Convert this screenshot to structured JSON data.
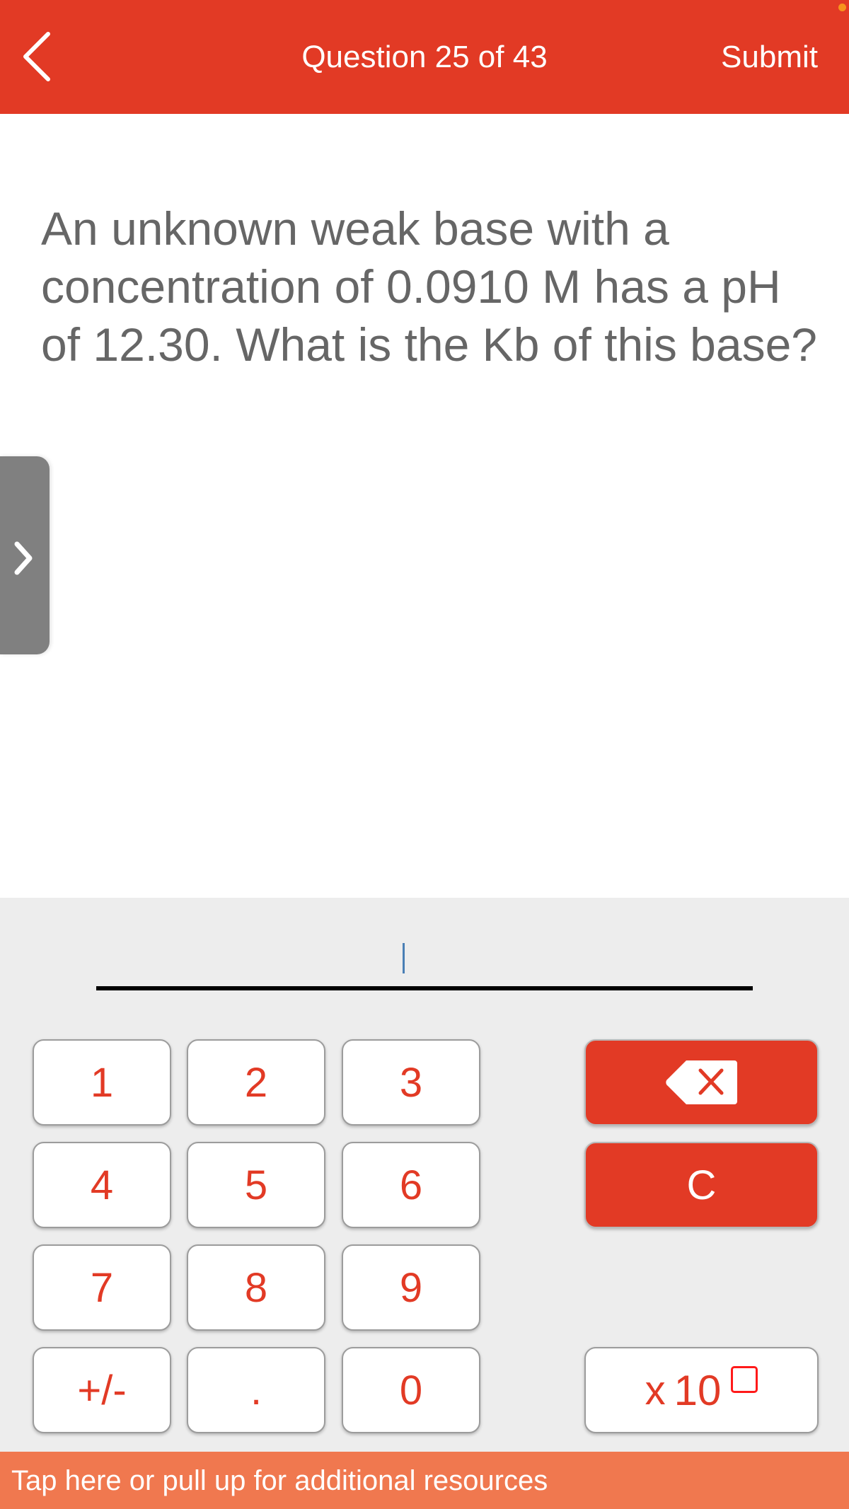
{
  "header": {
    "title": "Question 25 of 43",
    "submit_label": "Submit",
    "back_icon": "chevron-left-icon",
    "accent_color": "#E23A25",
    "status_dot_color": "#F7941D"
  },
  "question": {
    "text": "An unknown weak base with a concentration of 0.0910 M has a pH of 12.30. What is the Kb of this base?"
  },
  "side_tab": {
    "icon": "chevron-right-icon"
  },
  "answer": {
    "value": "",
    "cursor_visible": true
  },
  "keypad": {
    "digits": [
      {
        "label": "1"
      },
      {
        "label": "2"
      },
      {
        "label": "3"
      },
      {
        "label": "4"
      },
      {
        "label": "5"
      },
      {
        "label": "6"
      },
      {
        "label": "7"
      },
      {
        "label": "8"
      },
      {
        "label": "9"
      },
      {
        "label": "+/-"
      },
      {
        "label": "."
      },
      {
        "label": "0"
      }
    ],
    "backspace_icon": "backspace-icon",
    "clear_label": "C",
    "exponent_x": "x",
    "exponent_base": "10"
  },
  "resources_bar": {
    "label": "Tap here or pull up for additional resources",
    "color": "#F0784F"
  }
}
